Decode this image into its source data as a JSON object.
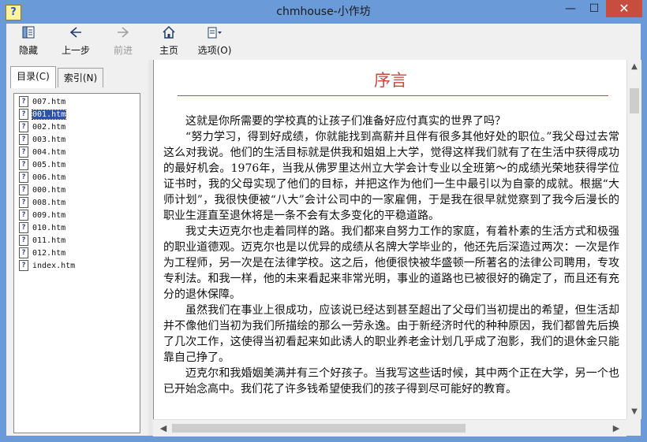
{
  "window": {
    "title": "chmhouse-小作坊",
    "min_glyph": "—",
    "max_glyph": "☐",
    "close_glyph": "✕",
    "app_icon_glyph": "?"
  },
  "toolbar": {
    "hide": {
      "label": "隐藏",
      "icon": "hide-pane-icon"
    },
    "back": {
      "label": "上一步",
      "icon": "back-arrow-icon"
    },
    "forward": {
      "label": "前进",
      "icon": "forward-arrow-icon"
    },
    "home": {
      "label": "主页",
      "icon": "home-icon"
    },
    "options": {
      "label": "选项(O)",
      "icon": "options-icon"
    }
  },
  "tabs": {
    "contents": "目录(C)",
    "index": "索引(N)"
  },
  "tree": {
    "items": [
      "007.htm",
      "001.htm",
      "002.htm",
      "003.htm",
      "004.htm",
      "005.htm",
      "006.htm",
      "000.htm",
      "008.htm",
      "009.htm",
      "010.htm",
      "011.htm",
      "012.htm",
      "index.htm"
    ],
    "selected": "001.htm"
  },
  "document": {
    "title": "序言",
    "paragraphs": [
      "这就是你所需要的学校真的让孩子们准备好应付真实的世界了吗？",
      "“努力学习，得到好成绩，你就能找到高薪并且伴有很多其他好处的职位。”我父母过去常这么对我说。他们的生活目标就是供我和姐姐上大学，觉得这样我们就有了在生活中获得成功的最好机会。1976年，当我从佛罗里达州立大学会计专业以全班第～的成绩光荣地获得学位证书时，我的父母实现了他们的目标，并把这作为他们一生中最引以为自豪的成就。根据“大师计划”，我很快便被“八大”会计公司中的一家雇佣，于是我在很早就觉察到了我今后漫长的职业生涯直至退休将是一条不会有太多变化的平稳道路。",
      "我丈夫迈克尔也走着同样的路。我们都来自努力工作的家庭，有着朴素的生活方式和极强的职业道德观。迈克尔也是以优异的成绩从名牌大学毕业的，他还先后深造过两次：一次是作为工程师，另一次是在法律学校。这之后，他便很快被华盛顿一所著名的法律公司聘用，专攻专利法。和我一样，他的未来看起来非常光明，事业的道路也已被很好的确定了，而且还有充分的退休保障。",
      "虽然我们在事业上很成功，应该说已经达到甚至超出了父母们当初提出的希望，但生活却并不像他们当初为我们所描绘的那么一劳永逸。由于新经济时代的种种原因，我们都曾先后换了几次工作，这使得当初看起来如此诱人的职业养老金计划几乎成了泡影，我们的退休金只能靠自己挣了。",
      "迈克尔和我婚姻美满并有三个好孩子。当我写这些话时候，其中两个正在大学，另一个也已开始念高中。我们花了许多钱希望使我们的孩子得到尽可能好的教育。"
    ]
  },
  "scroll": {
    "up": "▲",
    "down": "▼",
    "left": "◀",
    "right": "▶"
  }
}
